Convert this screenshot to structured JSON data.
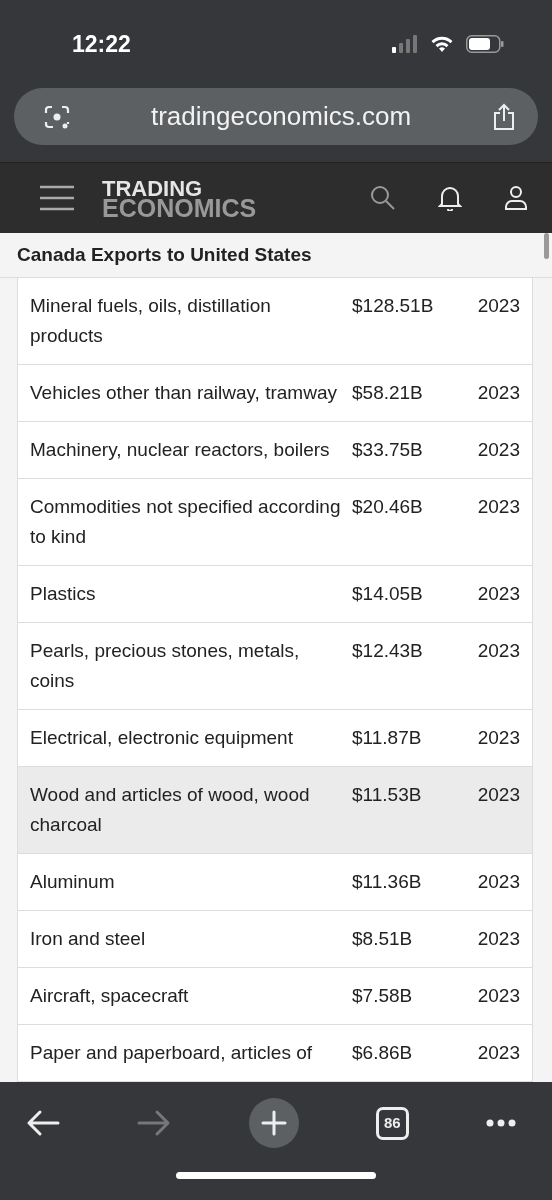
{
  "status_bar": {
    "time": "12:22"
  },
  "address_bar": {
    "url": "tradingeconomics.com"
  },
  "site_header": {
    "logo_line_1": "TRADING",
    "logo_line_2": "ECONOMICS"
  },
  "page_title": "Canada Exports to United States",
  "table": {
    "rows": [
      {
        "category": "Mineral fuels, oils, distillation products",
        "value": "$128.51B",
        "year": "2023",
        "selected": false
      },
      {
        "category": "Vehicles other than railway, tramway",
        "value": "$58.21B",
        "year": "2023",
        "selected": false
      },
      {
        "category": "Machinery, nuclear reactors, boilers",
        "value": "$33.75B",
        "year": "2023",
        "selected": false
      },
      {
        "category": "Commodities not specified according to kind",
        "value": "$20.46B",
        "year": "2023",
        "selected": false
      },
      {
        "category": "Plastics",
        "value": "$14.05B",
        "year": "2023",
        "selected": false
      },
      {
        "category": "Pearls, precious stones, metals, coins",
        "value": "$12.43B",
        "year": "2023",
        "selected": false
      },
      {
        "category": "Electrical, electronic equipment",
        "value": "$11.87B",
        "year": "2023",
        "selected": false
      },
      {
        "category": "Wood and articles of wood, wood charcoal",
        "value": "$11.53B",
        "year": "2023",
        "selected": true
      },
      {
        "category": "Aluminum",
        "value": "$11.36B",
        "year": "2023",
        "selected": false
      },
      {
        "category": "Iron and steel",
        "value": "$8.51B",
        "year": "2023",
        "selected": false
      },
      {
        "category": "Aircraft, spacecraft",
        "value": "$7.58B",
        "year": "2023",
        "selected": false
      },
      {
        "category": "Paper and paperboard, articles of",
        "value": "$6.86B",
        "year": "2023",
        "selected": false
      }
    ]
  },
  "toolbar": {
    "tab_count": "86"
  }
}
